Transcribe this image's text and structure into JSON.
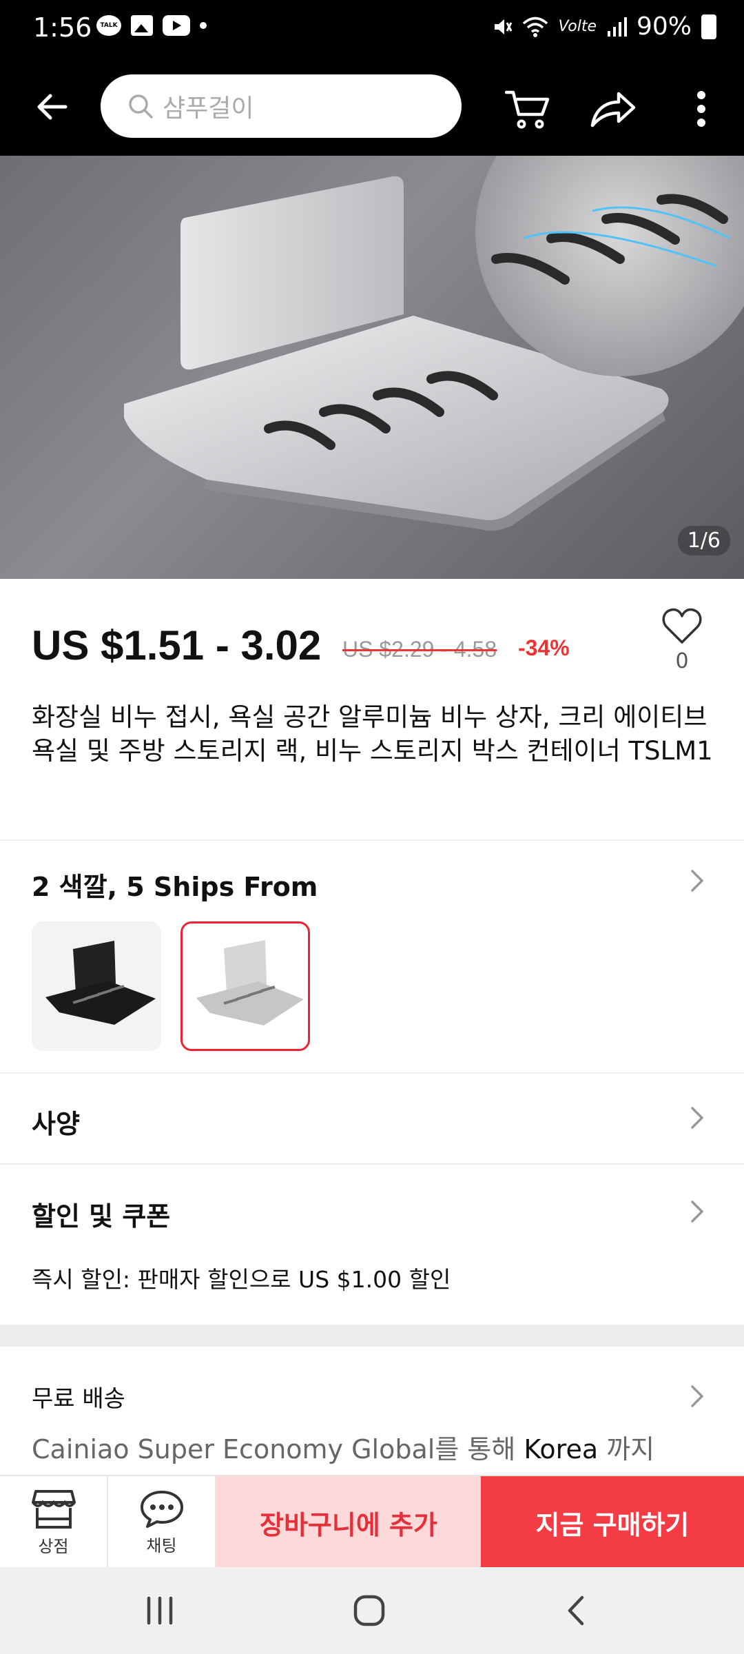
{
  "status_bar": {
    "time": "1:56",
    "talk_badge": "TALK",
    "network_label": "Volte",
    "battery": "90%"
  },
  "nav": {
    "search_placeholder": "샴푸걸이"
  },
  "gallery": {
    "counter": "1/6"
  },
  "product": {
    "price": "US $1.51 - 3.02",
    "original_price": "US $2.29 - 4.58",
    "discount": "-34%",
    "wishlist_count": "0",
    "title": "화장실 비누 접시, 욕실 공간 알루미늄 비누 상자, 크리 에이티브 욕실 및 주방 스토리지 랙, 비누 스토리지 박스 컨테이너 TSLM1"
  },
  "variants": {
    "title": "2 색깔, 5 Ships From",
    "options": [
      {
        "name": "black",
        "color": "#1e1e1e"
      },
      {
        "name": "silver",
        "color": "#c9c9cc",
        "selected": true
      }
    ]
  },
  "sections": {
    "specs_label": "사양",
    "coupons_label": "할인 및 쿠폰",
    "instant_discount": "즉시 할인: 판매자 할인으로 US $1.00 할인"
  },
  "shipping": {
    "label": "무료 배송",
    "carrier": "Cainiao Super Economy Global",
    "via": "를 통해 ",
    "destination": "Korea",
    "until": " 까지"
  },
  "actions": {
    "store_label": "상점",
    "chat_label": "채팅",
    "add_to_cart": "장바구니에 추가",
    "buy_now": "지금 구매하기"
  },
  "colors": {
    "accent": "#f43c45",
    "accent_light": "#fdd9d9",
    "discount": "#e33"
  },
  "icons": [
    "back-arrow-icon",
    "search-icon",
    "cart-icon",
    "share-icon",
    "more-vertical-icon",
    "heart-icon",
    "chevron-right-icon",
    "store-icon",
    "chat-icon",
    "recent-apps-icon",
    "home-icon",
    "back-icon"
  ]
}
